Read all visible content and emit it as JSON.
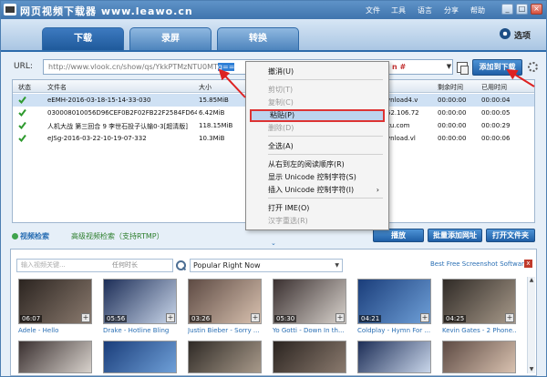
{
  "app": {
    "title": "网页视频下载器 www.leawo.cn",
    "menu": [
      "文件",
      "工具",
      "语言",
      "分享",
      "帮助"
    ],
    "window_buttons": {
      "minimize": "_",
      "maximize": "□",
      "close": "×"
    }
  },
  "tabs": [
    {
      "label": "下载",
      "active": true
    },
    {
      "label": "录屏",
      "active": false
    },
    {
      "label": "转换",
      "active": false
    }
  ],
  "options": {
    "label": "选项",
    "icon": "gear-icon"
  },
  "url_bar": {
    "label": "URL:",
    "value_unselected": "http://www.vlook.cn/show/qs/YkkPTMzNTU0MT",
    "value_selected": "g==",
    "hint": "n #",
    "add_button": "添加到下载",
    "paste_icon": "paste-icon",
    "settings_icon": "gear-icon"
  },
  "table": {
    "columns": [
      "状态",
      "文件名",
      "大小",
      "剩余时间",
      "已用时间"
    ],
    "rows": [
      {
        "name": "eEMH-2016-03-18-15-14-33-030",
        "size": "15.85MiB",
        "mid": "vnload4.v",
        "remaining": "00:00:00",
        "elapsed": "00:00:04",
        "selected": true
      },
      {
        "name": "030008010056D96CEF0B2F02FB22F2584FD64...",
        "size": "6.42MiB",
        "mid": "62.106.72",
        "remaining": "00:00:00",
        "elapsed": "00:00:05",
        "selected": false
      },
      {
        "name": "人机大战 第三回合 9 李世石投子认输0-3[超清版]",
        "size": "118.15MiB",
        "mid": "ku.com",
        "remaining": "00:00:00",
        "elapsed": "00:00:29",
        "selected": false
      },
      {
        "name": "eJSg-2016-03-22-10-19-07-332",
        "size": "10.3MiB",
        "mid": "vnload.vl",
        "remaining": "00:00:00",
        "elapsed": "00:00:06",
        "selected": false
      }
    ]
  },
  "context_menu": {
    "items": [
      {
        "label": "撤消(U)",
        "disabled": false
      },
      {
        "label": "剪切(T)",
        "disabled": true
      },
      {
        "label": "复制(C)",
        "disabled": true
      },
      {
        "label": "粘贴(P)",
        "disabled": false,
        "highlighted": true
      },
      {
        "label": "删除(D)",
        "disabled": true
      },
      {
        "label": "全选(A)",
        "disabled": false
      },
      {
        "label": "从右到左的阅读顺序(R)",
        "disabled": false
      },
      {
        "label": "显示 Unicode 控制字符(S)",
        "disabled": false
      },
      {
        "label": "插入 Unicode 控制字符(I)",
        "disabled": false,
        "submenu": "›"
      },
      {
        "label": "打开 IME(O)",
        "disabled": false
      },
      {
        "label": "汉字重选(R)",
        "disabled": true
      }
    ]
  },
  "bottom_bar": {
    "video_search": "视频检索",
    "advanced_search": "高级视频检索（支持RTMP）",
    "play_button": "播放",
    "batch_add_button": "批量添加网址",
    "open_folder_button": "打开文件夹",
    "expand": "⌄"
  },
  "video_browser": {
    "search_placeholder": "输入视频关键...",
    "search_hint": "任何时长",
    "category": "Popular Right Now",
    "ad_link": "Best Free Screenshot Software",
    "ad_close": "x",
    "videos": [
      {
        "title": "Adele - Hello",
        "duration": "06:07"
      },
      {
        "title": "Drake - Hotline Bling",
        "duration": "05:56"
      },
      {
        "title": "Justin Bieber - Sorry ...",
        "duration": "03:26"
      },
      {
        "title": "Yo Gotti - Down In th...",
        "duration": "05:30"
      },
      {
        "title": "Coldplay - Hymn For ...",
        "duration": "04:21"
      },
      {
        "title": "Kevin Gates - 2 Phone...",
        "duration": "04:25"
      }
    ]
  },
  "colors": {
    "accent": "#1f5fa6",
    "highlight_border": "#dd3333",
    "annotation": "#dd2222"
  }
}
